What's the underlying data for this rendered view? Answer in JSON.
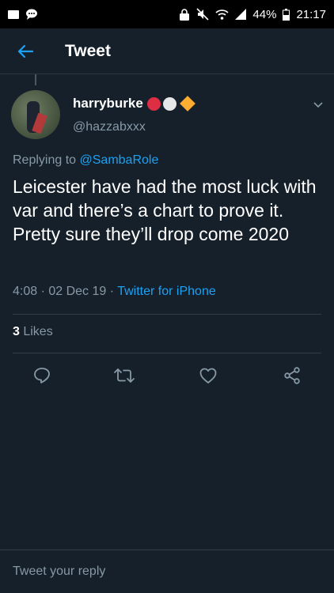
{
  "status_bar": {
    "battery": "44%",
    "time": "21:17"
  },
  "app_bar": {
    "title": "Tweet",
    "back_icon": "arrow-left-icon"
  },
  "tweet": {
    "display_name": "harryburke",
    "emoji_badges": [
      "red-circle",
      "white-circle",
      "orange-diamond"
    ],
    "handle": "@hazzabxxx",
    "replying_prefix": "Replying to ",
    "replying_to": "@SambaRole",
    "text": "Leicester have had the most luck with var and there’s a chart to prove it. Pretty sure they’ll drop come 2020",
    "time": "4:08 · 02 Dec 19 · ",
    "source": "Twitter for iPhone",
    "likes_count": "3",
    "likes_label": " Likes"
  },
  "actions": [
    "reply-icon",
    "retweet-icon",
    "like-icon",
    "share-icon"
  ],
  "reply_bar": {
    "placeholder": "Tweet your reply"
  },
  "colors": {
    "background": "#15202b",
    "accent": "#1da1f2",
    "muted": "#8899a6"
  }
}
